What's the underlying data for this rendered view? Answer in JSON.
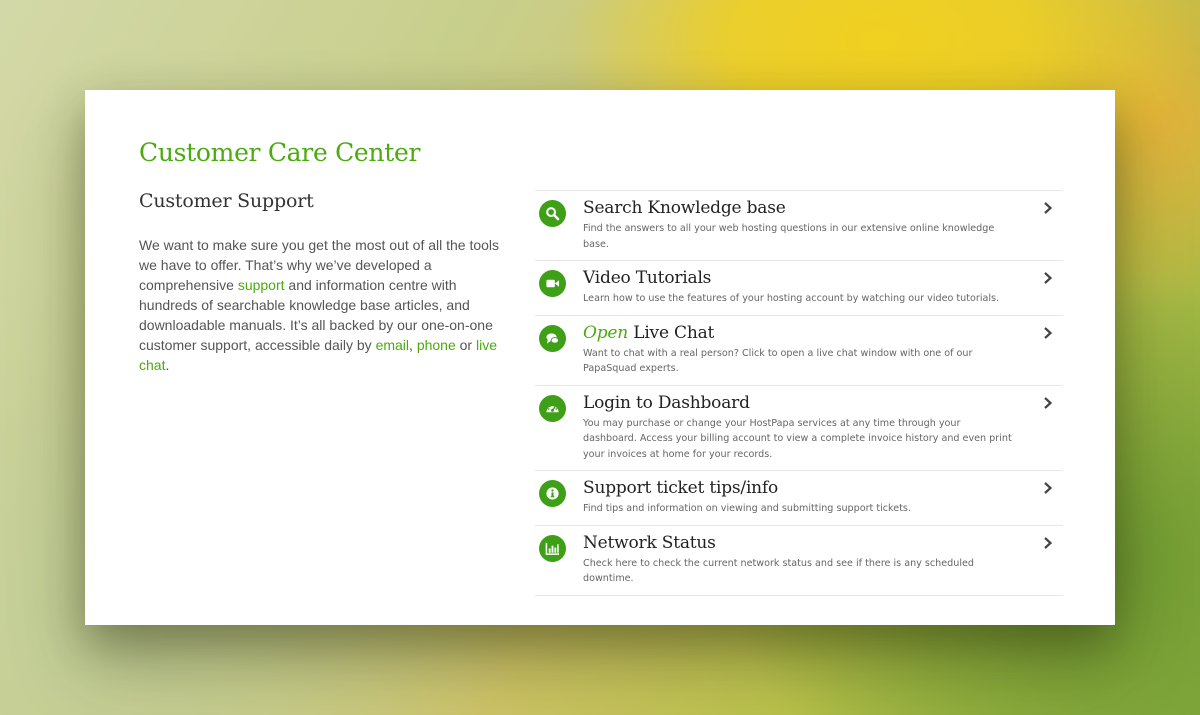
{
  "page_title": "Customer Care Center",
  "section_title": "Customer Support",
  "intro": {
    "part1": "We want to make sure you get the most out of all the tools we have to offer. That’s why we’ve developed a comprehensive ",
    "link_support": "support",
    "part2": " and information centre with hundreds of searchable knowledge base articles, and downloadable manuals. It’s all backed by our one-on-one customer support, accessible daily by ",
    "link_email": "email",
    "sep1": ", ",
    "link_phone": "phone",
    "sep2": " or ",
    "link_live_chat": "live chat",
    "end": "."
  },
  "items": [
    {
      "icon": "search-icon",
      "title": "Search Knowledge base",
      "desc": "Find the answers to all your web hosting questions in our extensive online knowledge base."
    },
    {
      "icon": "video-icon",
      "title": "Video Tutorials",
      "desc": "Learn how to use the features of your hosting account by watching our video tutorials."
    },
    {
      "icon": "chat-icon",
      "title_em": "Open",
      "title_rest": " Live Chat",
      "desc": "Want to chat with a real person? Click to open a live chat window with one of our PapaSquad experts."
    },
    {
      "icon": "dashboard-icon",
      "title": "Login to Dashboard",
      "desc": "You may purchase or change your HostPapa services at any time through your dashboard. Access your billing account to view a complete invoice history and even print your invoices at home for your records."
    },
    {
      "icon": "info-icon",
      "title": "Support ticket tips/info",
      "desc": "Find tips and information on viewing and submitting support tickets."
    },
    {
      "icon": "bar-chart-icon",
      "title": "Network Status",
      "desc": "Check here to check the current network status and see if there is any scheduled downtime."
    }
  ],
  "colors": {
    "accent": "#4caa10",
    "icon_bg": "#3da016",
    "text": "#333333"
  }
}
